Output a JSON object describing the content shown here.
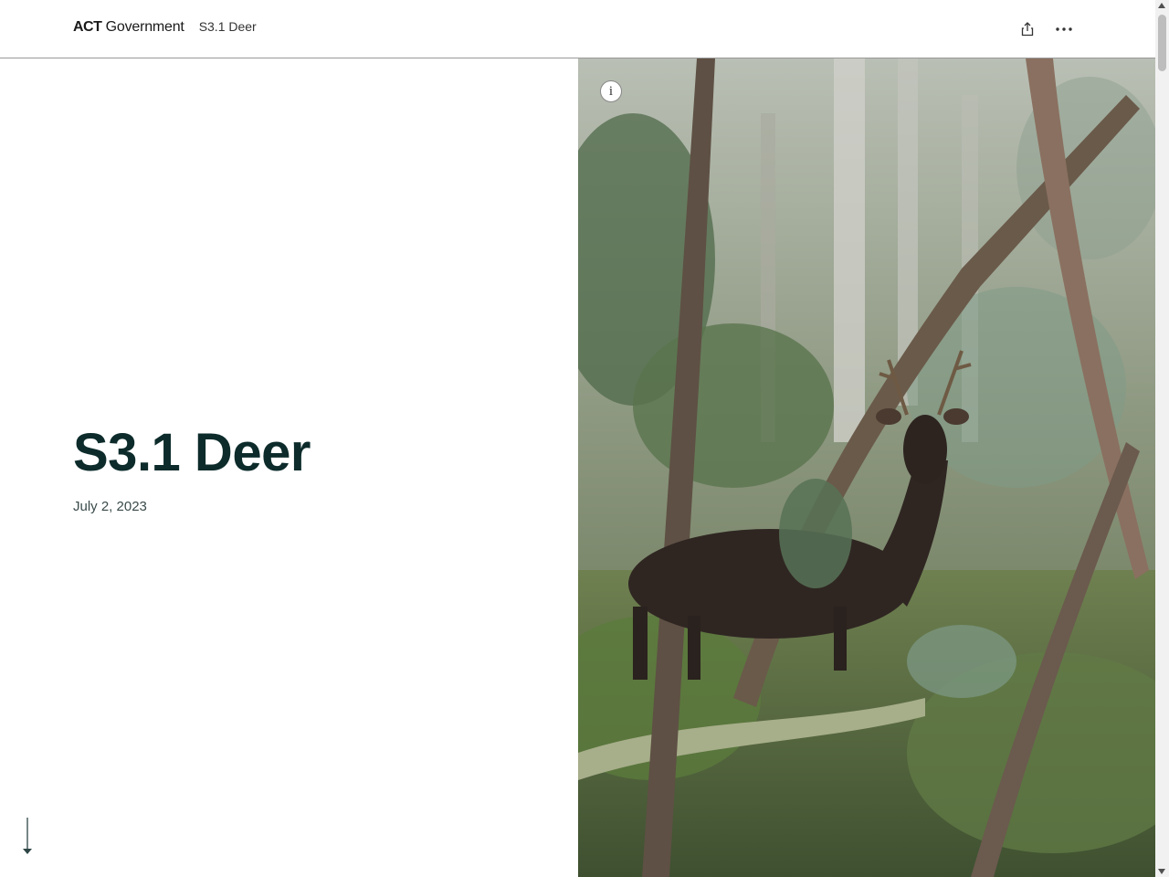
{
  "header": {
    "brand_prefix": "ACT",
    "brand_suffix": "Government",
    "story_title": "S3.1 Deer",
    "icons": [
      "share-icon",
      "more-icon"
    ]
  },
  "hero": {
    "title": "S3.1 Deer",
    "date": "July 2, 2023",
    "info_glyph": "i",
    "scroll_icon": "arrow-down-icon",
    "image_description_icon": "info-icon"
  },
  "colors": {
    "title": "#0d2b2b",
    "header_border": "#9a9a9a",
    "forest_dark": "#3e4a35",
    "forest_mid": "#6f7a63",
    "deer": "#2f2622"
  }
}
